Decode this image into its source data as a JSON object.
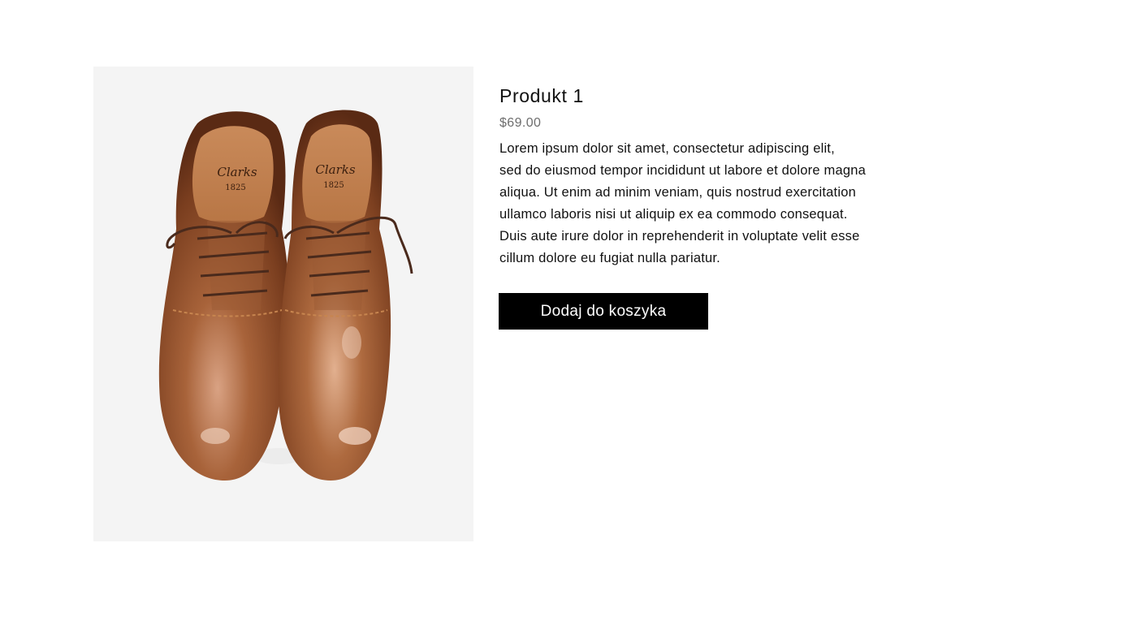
{
  "product": {
    "name": "Produkt 1",
    "price": "$69.00",
    "description_lines": [
      "Lorem ipsum dolor sit amet, consectetur adipiscing elit,",
      "sed do eiusmod tempor incididunt ut labore et dolore magna",
      "aliqua. Ut enim ad minim veniam, quis nostrud exercitation",
      "ullamco laboris nisi ut aliquip ex ea commodo consequat.",
      "Duis aute irure dolor in reprehenderit in voluptate velit esse",
      "cillum dolore eu fugiat nulla pariatur."
    ],
    "image": {
      "subject": "brown leather oxford shoes",
      "brand_mark": "Clarks",
      "brand_year": "1825"
    }
  },
  "actions": {
    "add_to_cart_label": "Dodaj do koszyka"
  },
  "colors": {
    "button_bg": "#000000",
    "button_text": "#ffffff",
    "price_text": "#6e6e6e",
    "image_bg": "#f4f4f4",
    "leather": "#8a4f2c"
  }
}
